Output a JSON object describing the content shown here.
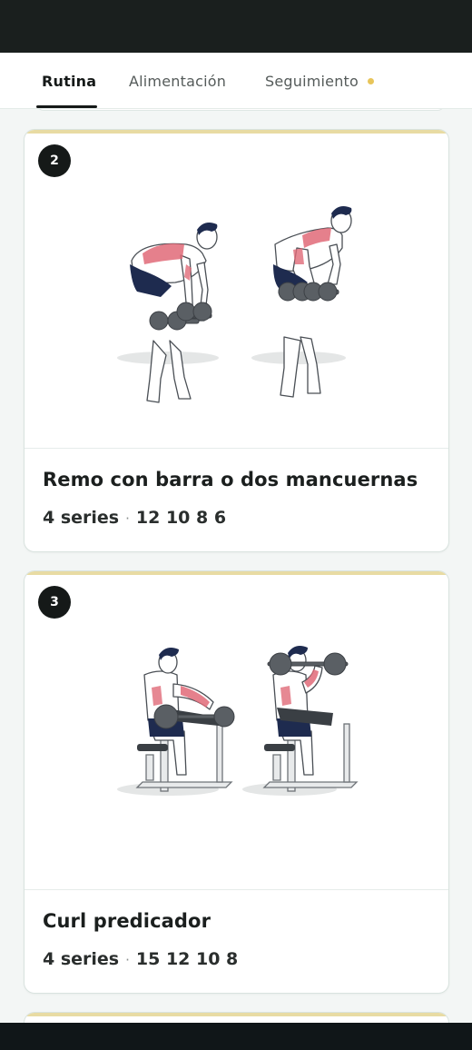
{
  "tabs": [
    {
      "label": "Rutina",
      "active": true
    },
    {
      "label": "Alimentación",
      "active": false
    },
    {
      "label": "Seguimiento",
      "active": false,
      "indicator_color": "#e8c55a"
    }
  ],
  "colors": {
    "status_bar": "#1a1f1e",
    "accent_stripe": "#e8dba3",
    "badge": "#151918",
    "muscle_highlight": "#e06a78",
    "shorts": "#1e2b4f"
  },
  "exercises": [
    {
      "number": "2",
      "name": "Remo con barra o dos mancuernas",
      "series": "4 series",
      "reps": "12 10 8 6",
      "illustration": "bent-over-row-illustration"
    },
    {
      "number": "3",
      "name": "Curl predicador",
      "series": "4 series",
      "reps": "15 12 10 8",
      "illustration": "preacher-curl-illustration"
    }
  ],
  "separator": "·"
}
